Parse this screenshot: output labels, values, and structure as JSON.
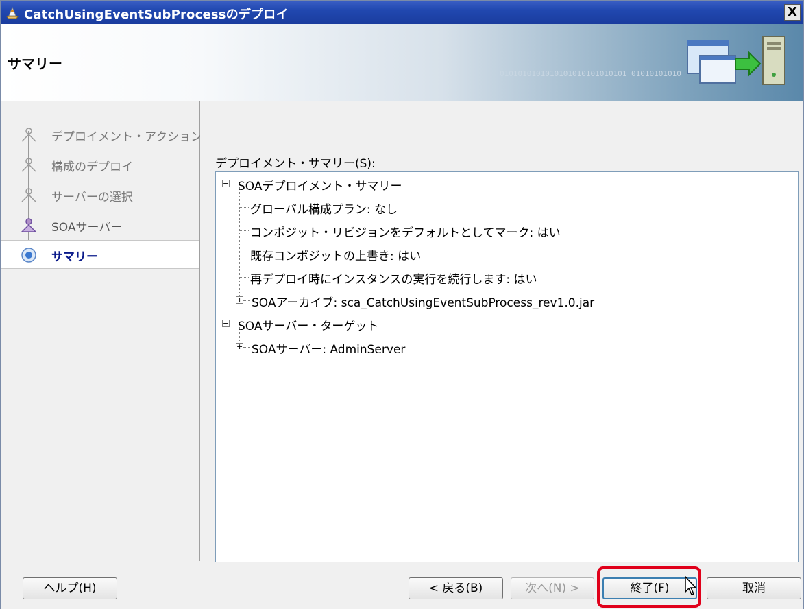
{
  "window": {
    "title": "CatchUsingEventSubProcessのデプロイ",
    "close_label": "X"
  },
  "banner": {
    "title": "サマリー",
    "binary_text": "0101010101010101010101010101 01010101010"
  },
  "nav": {
    "steps": [
      {
        "label": "デプロイメント・アクション",
        "state": "visited"
      },
      {
        "label": "構成のデプロイ",
        "state": "visited"
      },
      {
        "label": "サーバーの選択",
        "state": "visited"
      },
      {
        "label": "SOAサーバー",
        "state": "done"
      },
      {
        "label": "サマリー",
        "state": "current"
      }
    ]
  },
  "main": {
    "summary_label": "デプロイメント・サマリー(S):",
    "tree": {
      "soa_summary": {
        "label": "SOAデプロイメント・サマリー",
        "children": [
          "グローバル構成プラン: なし",
          "コンポジット・リビジョンをデフォルトとしてマーク: はい",
          "既存コンポジットの上書き: はい",
          "再デプロイ時にインスタンスの実行を続行します: はい"
        ],
        "archive": "SOAアーカイブ: sca_CatchUsingEventSubProcess_rev1.0.jar"
      },
      "server_target": {
        "label": "SOAサーバー・ターゲット",
        "server": "SOAサーバー: AdminServer"
      }
    }
  },
  "footer": {
    "help": "ヘルプ(H)",
    "back": "< 戻る(B)",
    "next": "次へ(N) >",
    "finish": "終了(F)",
    "cancel": "取消"
  },
  "colors": {
    "titlebar": "#2148b0",
    "highlight": "#e0001a",
    "active_step": "#0a1a8a"
  }
}
